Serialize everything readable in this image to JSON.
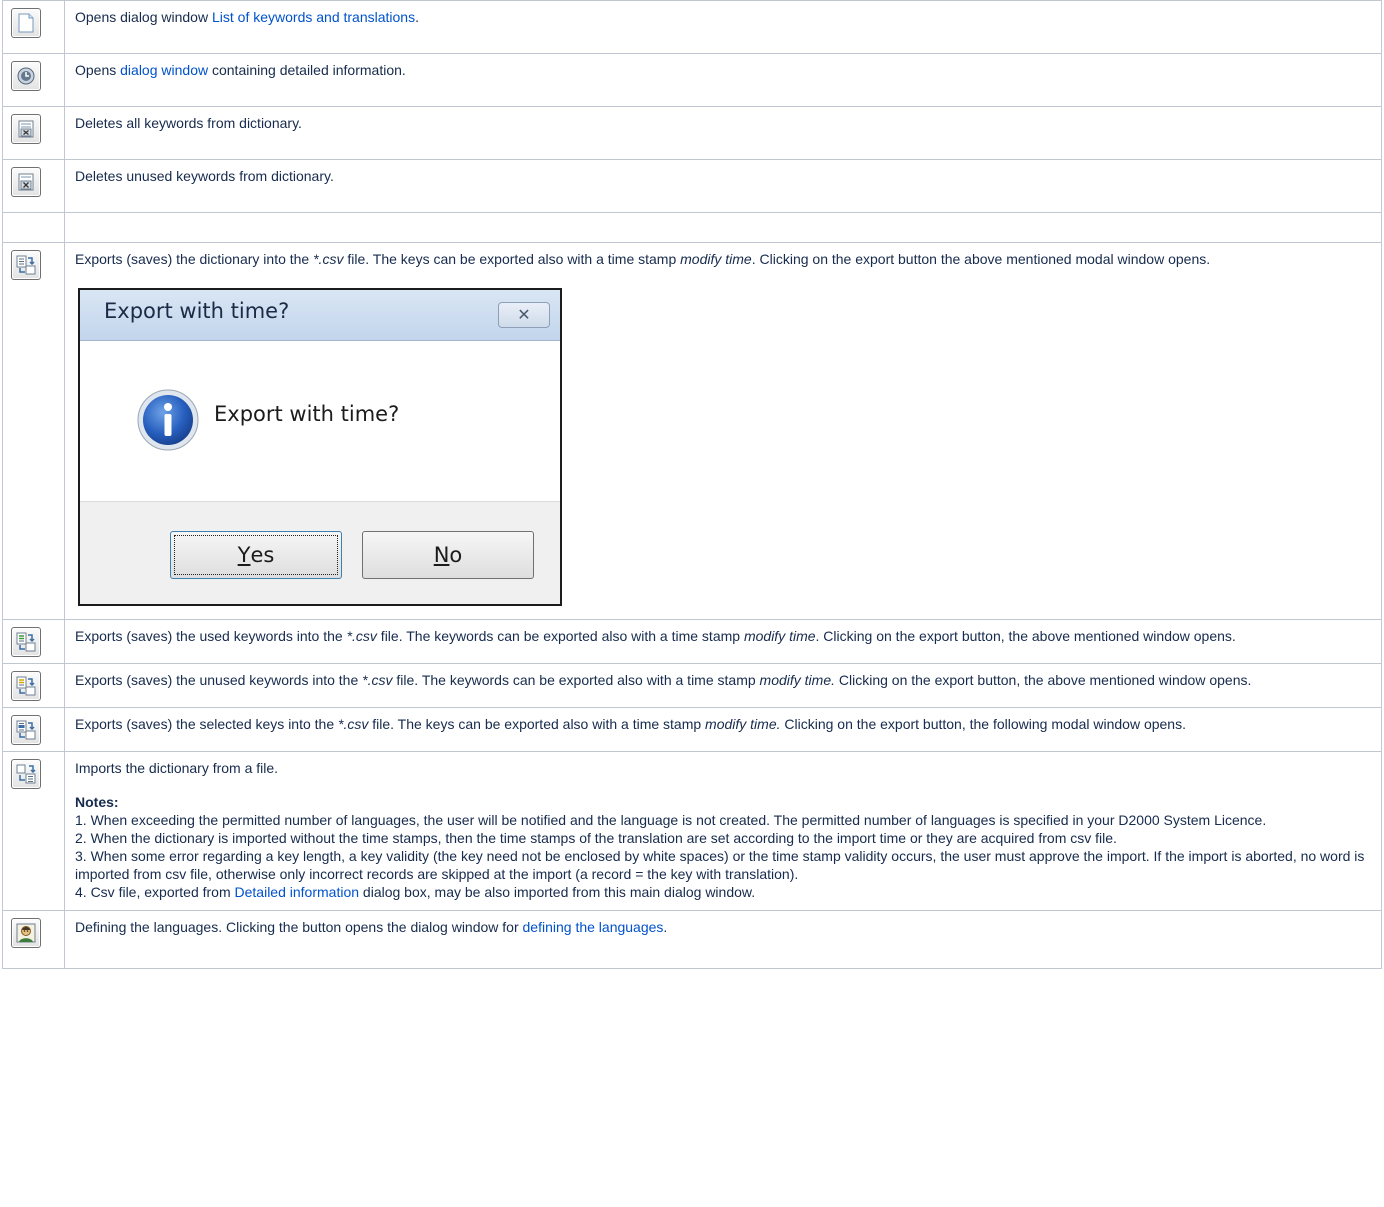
{
  "rows": [
    {
      "icon": "new-document-icon",
      "before": "Opens dialog window ",
      "link": "List of keywords and translations",
      "after": "."
    },
    {
      "icon": "clock-info-icon",
      "before": "Opens ",
      "link": "dialog window",
      "after": " containing detailed information."
    },
    {
      "icon": "delete-all-keywords-icon",
      "text": "Deletes all keywords from dictionary."
    },
    {
      "icon": "delete-unused-keywords-icon",
      "text": "Deletes unused keywords from dictionary."
    },
    {
      "icon": "export-dictionary-icon",
      "t1": "Exports (saves) the dictionary into the ",
      "em1": "*.csv",
      "t2": " file. The keys can be exported also with a time stamp ",
      "em2": "modify time",
      "t3": ". Clicking on the export button the above mentioned modal window opens."
    },
    {
      "icon": "export-used-keywords-icon",
      "t1": "Exports (saves) the used keywords into the ",
      "em1": "*.csv",
      "t2": " file. The keywords can be exported also with a time stamp ",
      "em2": "modify time",
      "t3": ". Clicking on the export button, the above mentioned window opens."
    },
    {
      "icon": "export-unused-keywords-icon",
      "t1": "Exports (saves) the unused keywords into the ",
      "em1": "*.csv",
      "t2": " file. The keywords can be exported also with a time stamp ",
      "em2": "modify time.",
      "t3": " Clicking on the export button, the above mentioned window opens."
    },
    {
      "icon": "export-selected-keys-icon",
      "t1": "Exports (saves) the selected keys into the ",
      "em1": "*.csv",
      "t2": " file. The keys can be exported also with a time stamp ",
      "em2": "modify time.",
      "t3": " Clicking on the export button, the following modal window opens."
    },
    {
      "icon": "import-dictionary-icon",
      "intro": "Imports the dictionary from a file.",
      "notes_title": "Notes:",
      "note1": "1. When exceeding the permitted number of languages, the user will be notified and the language is not created. The permitted number of languages is specified in your D2000 System Licence.",
      "note2": "2. When the dictionary is imported without the time stamps, then the time stamps of the translation are set according to the import time or they are acquired from csv file.",
      "note3": "3. When some error regarding a key length, a key validity (the key need not be enclosed by white spaces) or the time stamp validity occurs, the user must approve the import. If the import is aborted, no word is imported from csv file, otherwise only incorrect records are skipped at the import (a record = the key with translation).",
      "note4_before": "4. Csv file, exported from ",
      "note4_link": "Detailed information",
      "note4_after": " dialog box, may be also imported from this main dialog window."
    },
    {
      "icon": "define-languages-icon",
      "before": "Defining the languages. Clicking the button opens the dialog window for ",
      "link": "defining the languages",
      "after": "."
    }
  ],
  "dialog": {
    "title": "Export with time?",
    "message": "Export with time?",
    "yes_mnemonic": "Y",
    "yes_rest": "es",
    "no_mnemonic": "N",
    "no_rest": "o",
    "close_glyph": "✕"
  },
  "colors": {
    "link": "#0052cc",
    "border": "#c1c7d0",
    "text": "#172b4d"
  }
}
